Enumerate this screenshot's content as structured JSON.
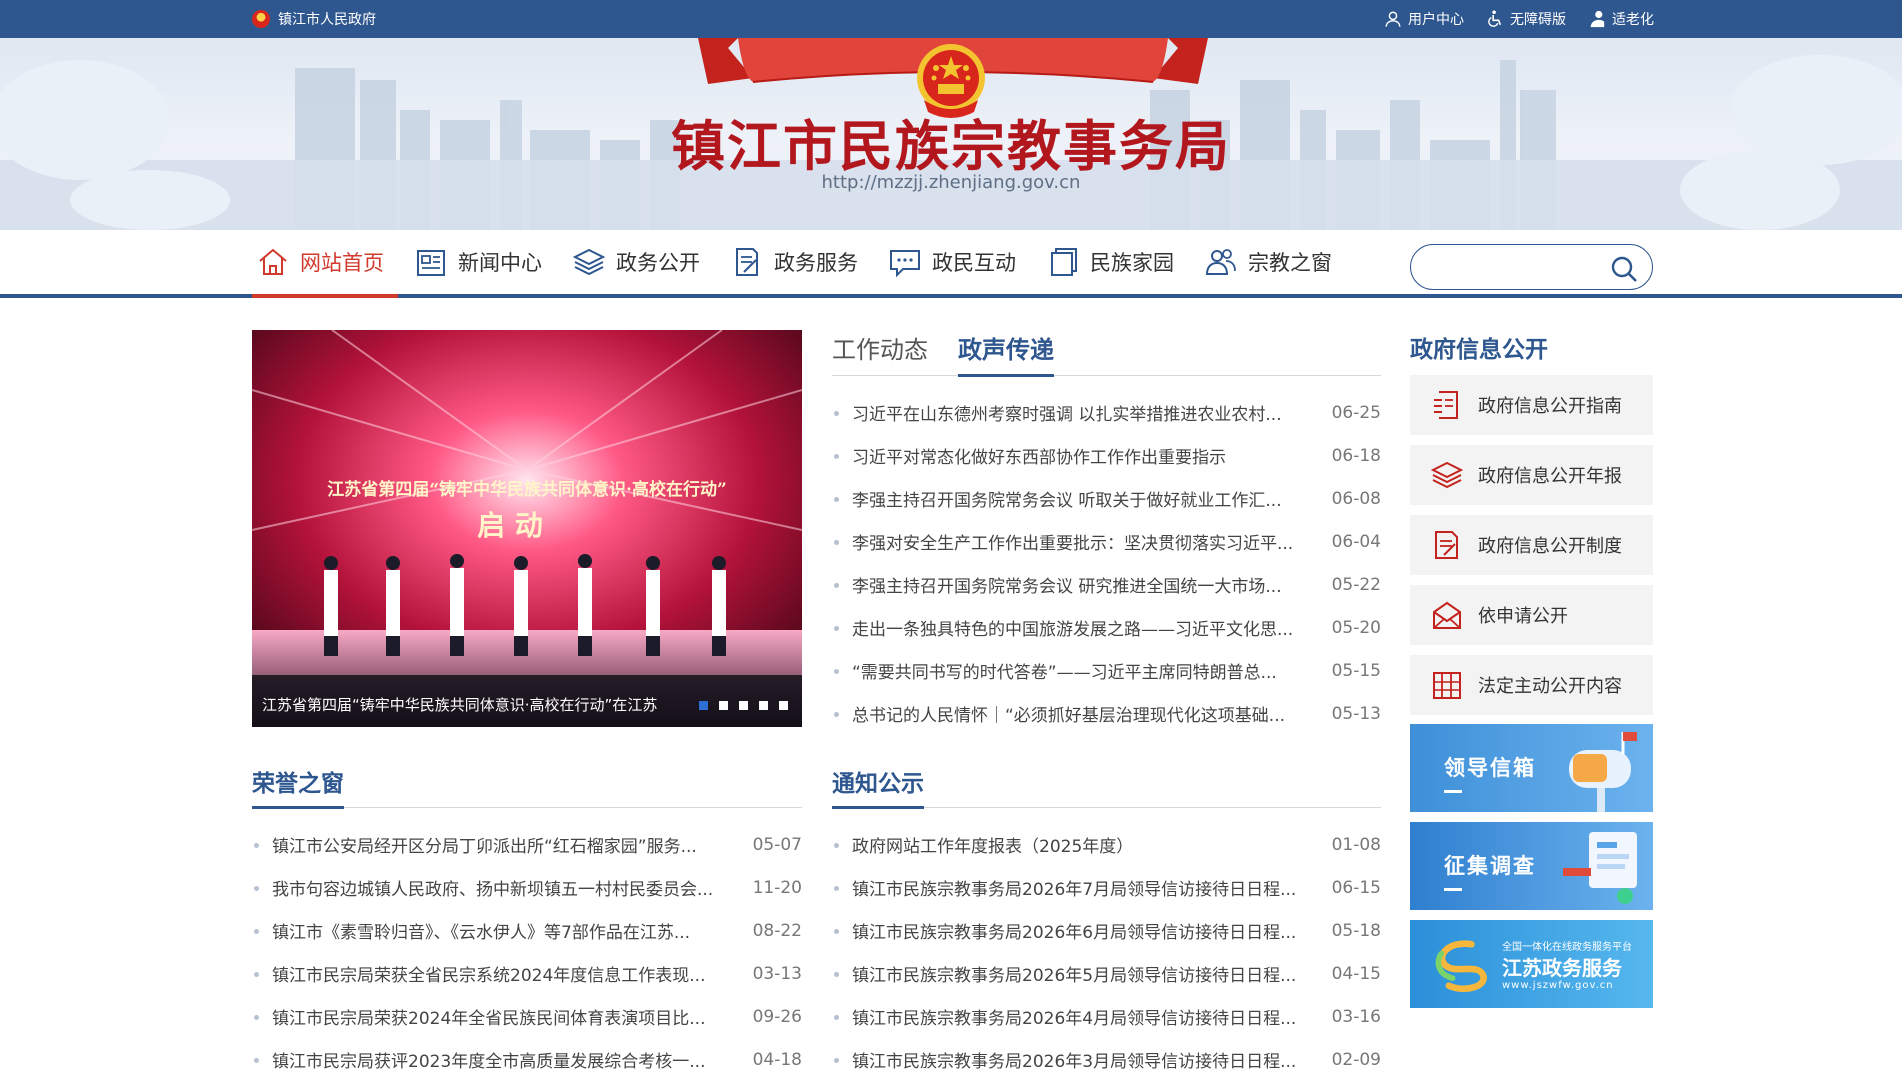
{
  "topbar": {
    "gov_link": "镇江市人民政府",
    "user_center": "用户中心",
    "accessible": "无障碍版",
    "elderly": "适老化"
  },
  "header": {
    "title": "镇江市民族宗教事务局",
    "url": "http://mzzjj.zhenjiang.gov.cn"
  },
  "nav": {
    "items": [
      {
        "label": "网站首页",
        "icon": "home-icon"
      },
      {
        "label": "新闻中心",
        "icon": "news-icon"
      },
      {
        "label": "政务公开",
        "icon": "layers-icon"
      },
      {
        "label": "政务服务",
        "icon": "form-icon"
      },
      {
        "label": "政民互动",
        "icon": "chat-icon"
      },
      {
        "label": "民族家园",
        "icon": "book-icon"
      },
      {
        "label": "宗教之窗",
        "icon": "people-icon"
      }
    ],
    "search_placeholder": ""
  },
  "carousel": {
    "caption": "江苏省第四届“铸牢中华民族共同体意识·高校在行动”在江苏",
    "stage_text": "江苏省第四届“铸牢中华民族共同体意识·高校在行动”",
    "stage_sub": "启 动",
    "dots": 5,
    "active_dot": 0
  },
  "news_tabs": {
    "tabs": [
      "工作动态",
      "政声传递"
    ],
    "active": 1,
    "items": [
      {
        "title": "习近平在山东德州考察时强调 以扎实举措推进农业农村...",
        "date": "06-25"
      },
      {
        "title": "习近平对常态化做好东西部协作工作作出重要指示",
        "date": "06-18"
      },
      {
        "title": "李强主持召开国务院常务会议 听取关于做好就业工作汇...",
        "date": "06-08"
      },
      {
        "title": "李强对安全生产工作作出重要批示：坚决贯彻落实习近平...",
        "date": "06-04"
      },
      {
        "title": "李强主持召开国务院常务会议 研究推进全国统一大市场...",
        "date": "05-22"
      },
      {
        "title": "走出一条独具特色的中国旅游发展之路——习近平文化思...",
        "date": "05-20"
      },
      {
        "title": "“需要共同书写的时代答卷”——习近平主席同特朗普总...",
        "date": "05-15"
      },
      {
        "title": "总书记的人民情怀｜“必须抓好基层治理现代化这项基础...",
        "date": "05-13"
      }
    ]
  },
  "honor": {
    "title": "荣誉之窗",
    "items": [
      {
        "title": "镇江市公安局经开区分局丁卯派出所“红石榴家园”服务...",
        "date": "05-07"
      },
      {
        "title": "我市句容边城镇人民政府、扬中新坝镇五一村村民委员会...",
        "date": "11-20"
      },
      {
        "title": "镇江市《素雪聆归音》、《云水伊人》等7部作品在江苏...",
        "date": "08-22"
      },
      {
        "title": "镇江市民宗局荣获全省民宗系统2024年度信息工作表现...",
        "date": "03-13"
      },
      {
        "title": "镇江市民宗局荣获2024年全省民族民间体育表演项目比...",
        "date": "09-26"
      },
      {
        "title": "镇江市民宗局获评2023年度全市高质量发展综合考核一...",
        "date": "04-18"
      }
    ]
  },
  "notice": {
    "title": "通知公示",
    "items": [
      {
        "title": "政府网站工作年度报表（2025年度）",
        "date": "01-08"
      },
      {
        "title": "镇江市民族宗教事务局2026年7月局领导信访接待日日程...",
        "date": "06-15"
      },
      {
        "title": "镇江市民族宗教事务局2026年6月局领导信访接待日日程...",
        "date": "05-18"
      },
      {
        "title": "镇江市民族宗教事务局2026年5月局领导信访接待日日程...",
        "date": "04-15"
      },
      {
        "title": "镇江市民族宗教事务局2026年4月局领导信访接待日日程...",
        "date": "03-16"
      },
      {
        "title": "镇江市民族宗教事务局2026年3月局领导信访接待日日程...",
        "date": "02-09"
      }
    ]
  },
  "sidebar": {
    "title": "政府信息公开",
    "items": [
      {
        "label": "政府信息公开指南",
        "icon": "guide-icon"
      },
      {
        "label": "政府信息公开年报",
        "icon": "layers-icon"
      },
      {
        "label": "政府信息公开制度",
        "icon": "document-icon"
      },
      {
        "label": "依申请公开",
        "icon": "envelope-icon"
      },
      {
        "label": "法定主动公开内容",
        "icon": "list-icon"
      }
    ],
    "banners": [
      {
        "label": "领导信箱",
        "icon": "mailbox-icon"
      },
      {
        "label": "征集调查",
        "icon": "survey-icon"
      },
      {
        "label": "江苏政务服务",
        "sub": "www.jszwfw.gov.cn",
        "tag": "全国一体化在线政务服务平台",
        "icon": "jiangsu-logo-icon"
      }
    ]
  },
  "colors": {
    "primary": "#2e568f",
    "accent_red": "#d0392c",
    "title_red": "#b3171e"
  }
}
